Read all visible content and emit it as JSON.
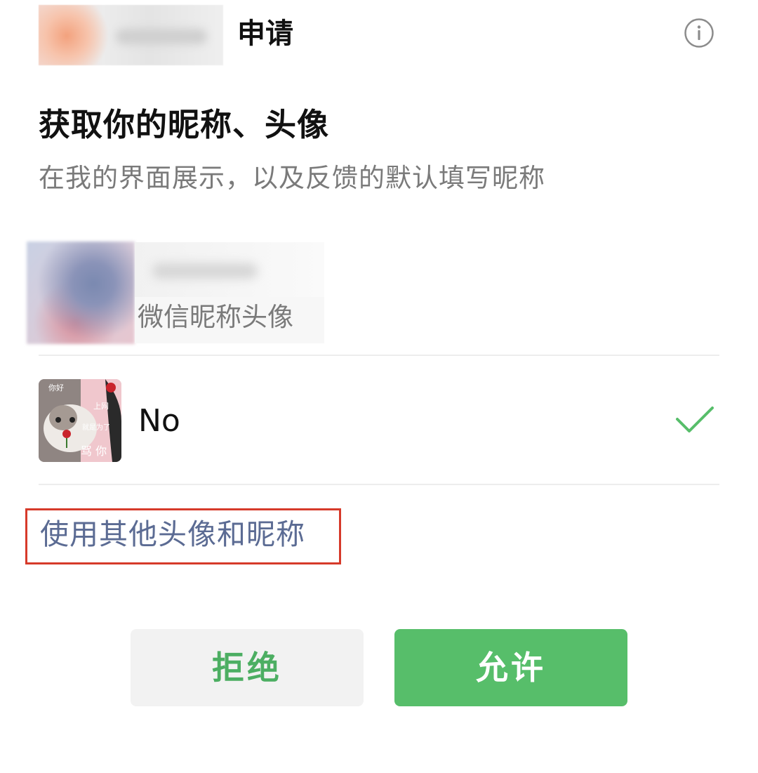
{
  "header": {
    "title": "申请",
    "info_icon": "info-icon"
  },
  "main": {
    "title": "获取你的昵称、头像",
    "subtitle": "在我的界面展示，以及反馈的默认填写昵称"
  },
  "options": [
    {
      "label": "微信昵称头像",
      "selected": false,
      "avatar_icon": "wechat-avatar"
    },
    {
      "nickname": "No",
      "selected": true,
      "avatar_icon": "cat-meme-avatar",
      "avatar_text": [
        "你好",
        "上网",
        "就是为了",
        "骂 你"
      ]
    }
  ],
  "alt_link": "使用其他头像和昵称",
  "buttons": {
    "deny": "拒绝",
    "allow": "允许"
  },
  "colors": {
    "accent_green": "#57be6a",
    "deny_text": "#4cae62",
    "link_blue": "#5b6b93",
    "highlight_red": "#d63a2a"
  }
}
